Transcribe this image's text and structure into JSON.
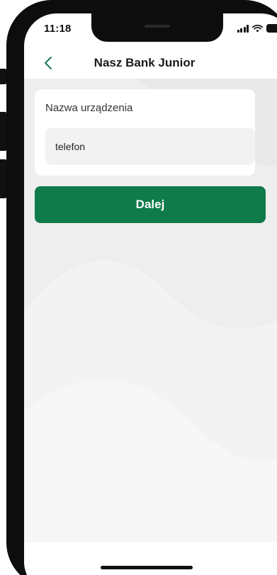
{
  "status_bar": {
    "time": "11:18",
    "icons": [
      "signal-icon",
      "wifi-icon",
      "battery-icon"
    ]
  },
  "header": {
    "back_icon": "chevron-left-icon",
    "title": "Nasz Bank Junior"
  },
  "form": {
    "device_name_label": "Nazwa urządzenia",
    "device_name_value": "telefon"
  },
  "actions": {
    "next_label": "Dalej"
  },
  "colors": {
    "accent": "#0f7b4a",
    "back_chevron": "#1a7a4e",
    "content_background": "#eeeeee"
  }
}
